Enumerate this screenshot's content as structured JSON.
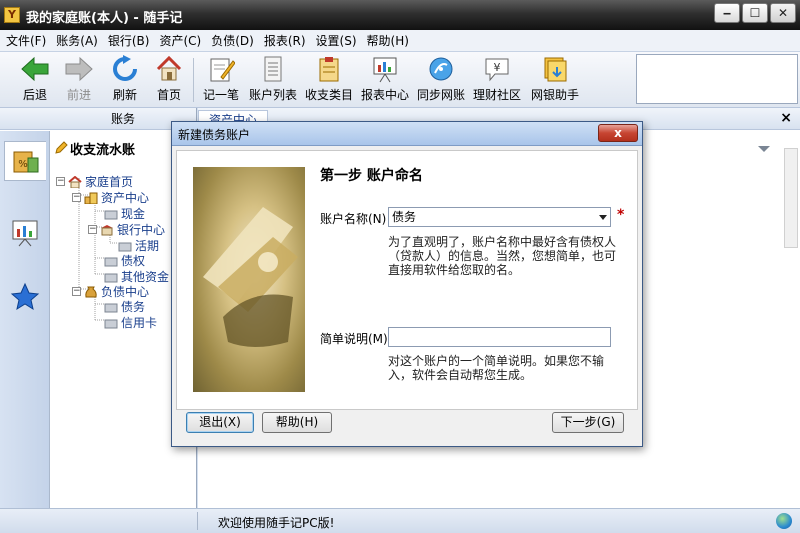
{
  "window": {
    "title": "我的家庭账(本人) - 随手记",
    "app_icon": "Y"
  },
  "menu": [
    "文件(F)",
    "账务(A)",
    "银行(B)",
    "资产(C)",
    "负债(D)",
    "报表(R)",
    "设置(S)",
    "帮助(H)"
  ],
  "toolbar": {
    "back": "后退",
    "forward": "前进",
    "refresh": "刷新",
    "home": "首页",
    "record": "记一笔",
    "accounts": "账户列表",
    "categories": "收支类目",
    "reports": "报表中心",
    "sync": "同步网账",
    "community": "理财社区",
    "assistant": "网银助手"
  },
  "left_panel": {
    "header": "账务",
    "tree_title": "收支流水账",
    "tree": {
      "home": "家庭首页",
      "assets": "资产中心",
      "cash": "现金",
      "bank": "银行中心",
      "current": "活期",
      "claims": "债权",
      "other_funds": "其他资金",
      "liabilities": "负债中心",
      "debt": "债务",
      "credit_card": "信用卡"
    }
  },
  "right_panel": {
    "tab": "资产中心",
    "close": "×"
  },
  "status": {
    "text": "欢迎使用随手记PC版!"
  },
  "dialog": {
    "title": "新建债务账户",
    "close": "x",
    "step_title": "第一步   账户命名",
    "name_label": "账户名称(N)",
    "name_value": "债务",
    "required_mark": "*",
    "name_hint": "为了直观明了，账户名称中最好含有债权人（贷款人）的信息。当然，您想简单，也可直接用软件给您取的名。",
    "desc_label": "简单说明(M)",
    "desc_value": "",
    "desc_hint": "对这个账户的一个简单说明。如果您不输入，软件会自动帮您生成。",
    "buttons": {
      "exit": "退出(X)",
      "help": "帮助(H)",
      "next": "下一步(G)"
    }
  },
  "colors": {
    "title_bar": "#2f2f2f",
    "accent": "#1a3f8c",
    "required": "#c00000"
  }
}
